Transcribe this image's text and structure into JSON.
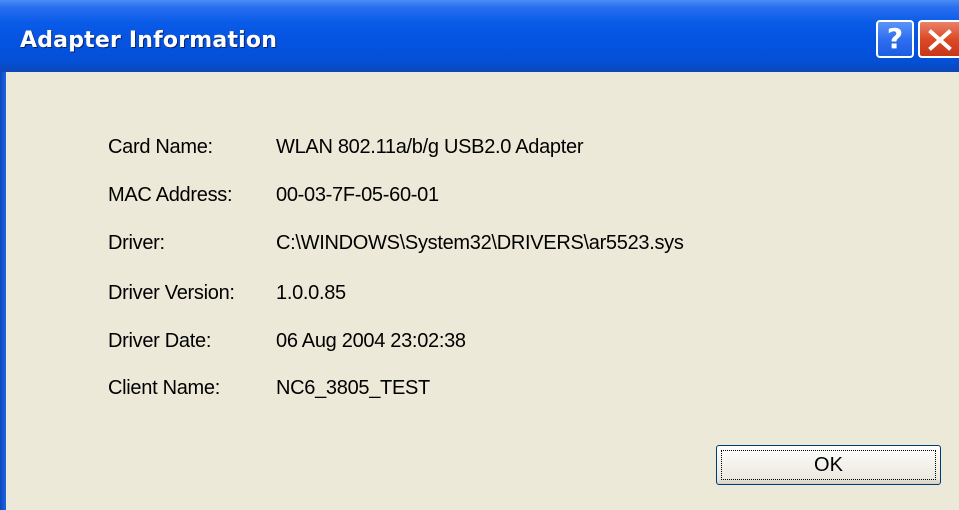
{
  "window": {
    "title": "Adapter Information",
    "help_label": "?",
    "close_icon": "close-icon"
  },
  "fields": [
    {
      "label": "Card Name:",
      "value": "WLAN 802.11a/b/g USB2.0 Adapter"
    },
    {
      "label": "MAC Address:",
      "value": "00-03-7F-05-60-01"
    },
    {
      "label": "Driver:",
      "value": "C:\\WINDOWS\\System32\\DRIVERS\\ar5523.sys"
    },
    {
      "label": "Driver Version:",
      "value": "1.0.0.85"
    },
    {
      "label": "Driver Date:",
      "value": "06 Aug 2004 23:02:38"
    },
    {
      "label": "Client Name:",
      "value": "NC6_3805_TEST"
    }
  ],
  "buttons": {
    "ok_label": "OK"
  },
  "colors": {
    "titlebar": "#0452e0",
    "dialog_background": "#ece9d8",
    "close_button": "#dc4a25"
  }
}
